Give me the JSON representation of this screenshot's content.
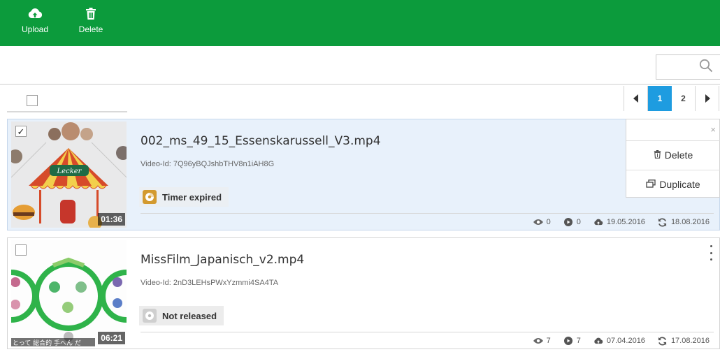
{
  "toolbar": {
    "upload_label": "Upload",
    "delete_label": "Delete",
    "upload_icon": "cloud-upload-icon",
    "delete_icon": "trash-icon",
    "bg_color": "#0c9b3c"
  },
  "search": {
    "placeholder": ""
  },
  "pagination": {
    "pages": [
      "1",
      "2"
    ],
    "active_page": "1",
    "active_color": "#1e9ce0"
  },
  "videos": [
    {
      "title": "002_ms_49_15_Essenskarussell_V3.mp4",
      "video_id": "Video-Id: 7Q96yBQJshbTHV8n1iAH8G",
      "status": "Timer expired",
      "status_color": "#d39a2f",
      "duration": "01:36",
      "checked": true,
      "views": "0",
      "plays": "0",
      "uploaded": "19.05.2016",
      "updated": "18.08.2016",
      "thumb_text": "Lecker"
    },
    {
      "title": "MissFilm_Japanisch_v2.mp4",
      "video_id": "Video-Id: 2nD3LEHsPWxYzmmi4SA4TA",
      "status": "Not released",
      "status_color": "#cfcfcf",
      "duration": "06:21",
      "checked": false,
      "views": "7",
      "plays": "7",
      "uploaded": "07.04.2016",
      "updated": "17.08.2016",
      "thumb_text": "とって 総合的 手へん だ"
    }
  ],
  "context_menu": {
    "close_glyph": "×",
    "delete_label": "Delete",
    "duplicate_label": "Duplicate"
  }
}
